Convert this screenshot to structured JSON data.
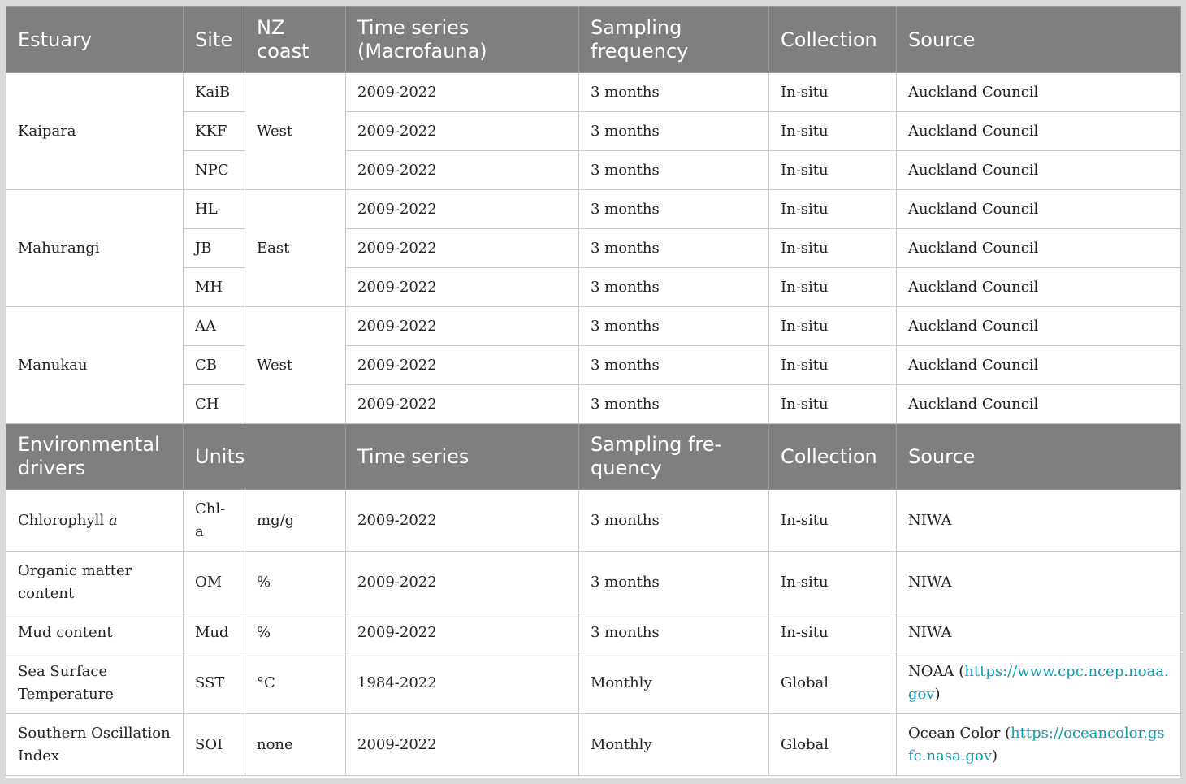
{
  "header1": [
    "Estuary",
    "Site",
    "NZ coast",
    "Time series (Macrofauna)",
    "Sampling frequency",
    "Collection",
    "Source"
  ],
  "estuaries": [
    {
      "name": "Kaipara",
      "coast": "West",
      "sites": [
        {
          "site": "KaiB",
          "time": "2009-2022",
          "freq": "3 months",
          "collection": "In-situ",
          "source": "Auckland Council"
        },
        {
          "site": "KKF",
          "time": "2009-2022",
          "freq": "3 months",
          "collection": "In-situ",
          "source": "Auckland Council"
        },
        {
          "site": "NPC",
          "time": "2009-2022",
          "freq": "3 months",
          "collection": "In-situ",
          "source": "Auckland Council"
        }
      ]
    },
    {
      "name": "Mahurangi",
      "coast": "East",
      "sites": [
        {
          "site": "HL",
          "time": "2009-2022",
          "freq": "3 months",
          "collection": "In-situ",
          "source": "Auckland Council"
        },
        {
          "site": "JB",
          "time": "2009-2022",
          "freq": "3 months",
          "collection": "In-situ",
          "source": "Auckland Council"
        },
        {
          "site": "MH",
          "time": "2009-2022",
          "freq": "3 months",
          "collection": "In-situ",
          "source": "Auckland Council"
        }
      ]
    },
    {
      "name": "Manukau",
      "coast": "West",
      "sites": [
        {
          "site": "AA",
          "time": "2009-2022",
          "freq": "3 months",
          "collection": "In-situ",
          "source": "Auckland Council"
        },
        {
          "site": "CB",
          "time": "2009-2022",
          "freq": "3 months",
          "collection": "In-situ",
          "source": "Auckland Council"
        },
        {
          "site": "CH",
          "time": "2009-2022",
          "freq": "3 months",
          "collection": "In-situ",
          "source": "Auckland Council"
        }
      ]
    }
  ],
  "header2": [
    "Environmental drivers",
    "Units",
    "Time series",
    "Sampling fre-quency",
    "Collection",
    "Source"
  ],
  "drivers": [
    {
      "name": "Chlorophyll",
      "name_italic": "a",
      "abbr": "Chl-a",
      "units": "mg/g",
      "time": "2009-2022",
      "freq": "3 months",
      "collection": "In-situ",
      "source": "NIWA",
      "link": ""
    },
    {
      "name": "Organic matter content",
      "name_italic": "",
      "abbr": "OM",
      "units": "%",
      "time": "2009-2022",
      "freq": "3 months",
      "collection": "In-situ",
      "source": "NIWA",
      "link": ""
    },
    {
      "name": "Mud content",
      "name_italic": "",
      "abbr": "Mud",
      "units": "%",
      "time": "2009-2022",
      "freq": "3 months",
      "collection": "In-situ",
      "source": "NIWA",
      "link": ""
    },
    {
      "name": "Sea Surface Temperature",
      "name_italic": "",
      "abbr": "SST",
      "units": "°C",
      "time": "1984-2022",
      "freq": "Monthly",
      "collection": "Global",
      "source": "NOAA",
      "link": "https://www.cpc.ncep.noaa.gov"
    },
    {
      "name": "Southern Oscillation Index",
      "name_italic": "",
      "abbr": "SOI",
      "units": "none",
      "time": "2009-2022",
      "freq": "Monthly",
      "collection": "Global",
      "source": "Ocean Color",
      "link": "https://oceancolor.gsfc.nasa.gov"
    }
  ],
  "colors": {
    "header_bg": "#7f7f7f",
    "link": "#0c9bb5",
    "page_bg": "#d9d9d9"
  }
}
